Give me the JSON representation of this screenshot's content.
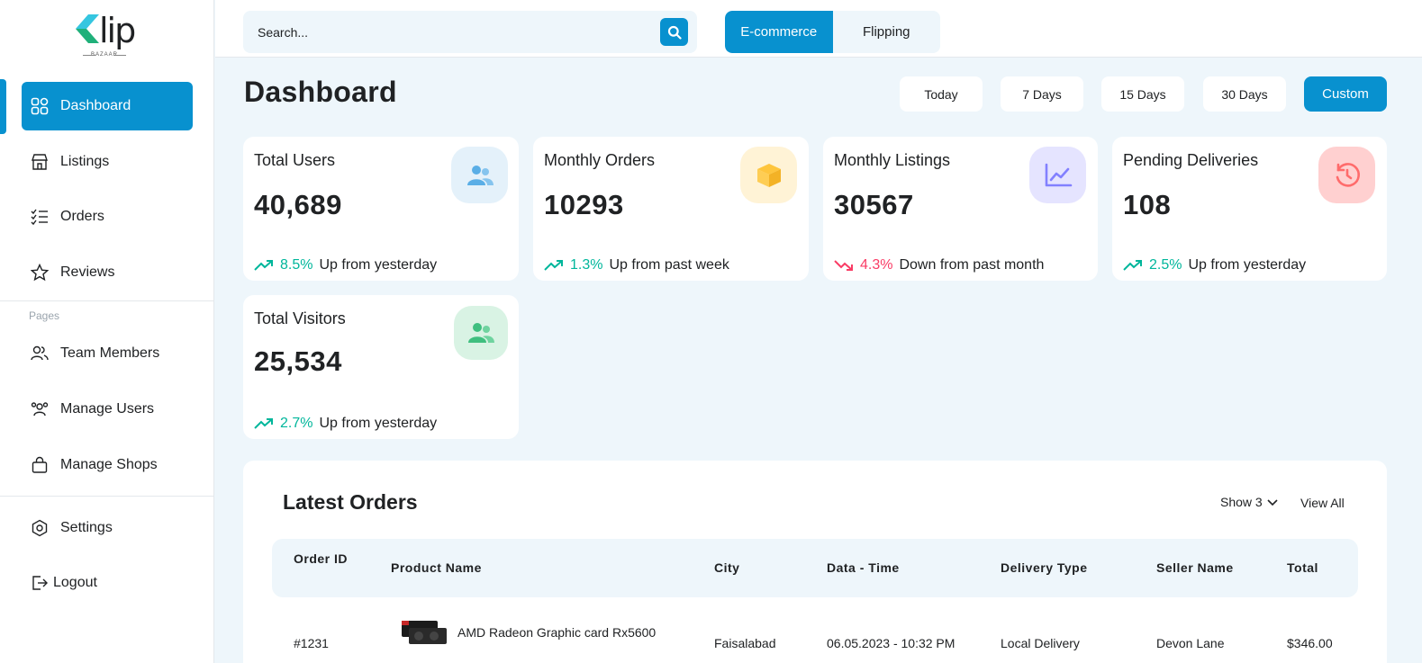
{
  "brand": {
    "logo_text": "lip",
    "logo_sub": "BAZAAR"
  },
  "sidebar": {
    "items": [
      {
        "label": "Dashboard"
      },
      {
        "label": "Listings"
      },
      {
        "label": "Orders"
      },
      {
        "label": "Reviews"
      }
    ],
    "section_label": "Pages",
    "pages": [
      {
        "label": "Team Members"
      },
      {
        "label": "Manage Users"
      },
      {
        "label": "Manage Shops"
      }
    ],
    "bottom": [
      {
        "label": "Settings"
      },
      {
        "label": "Logout"
      }
    ]
  },
  "topbar": {
    "search_placeholder": "Search...",
    "segments": [
      "E-commerce",
      "Flipping"
    ],
    "active_segment": "E-commerce"
  },
  "header": {
    "title": "Dashboard",
    "ranges": [
      "Today",
      "7 Days",
      "15 Days",
      "30 Days",
      "Custom"
    ],
    "active_range": "Custom"
  },
  "cards": [
    {
      "title": "Total Users",
      "value": "40,689",
      "pct": "8.5%",
      "trend_text": "Up from yesterday",
      "direction": "up",
      "icon": "users-icon"
    },
    {
      "title": "Monthly Orders",
      "value": "10293",
      "pct": "1.3%",
      "trend_text": "Up from past week",
      "direction": "up",
      "icon": "box-icon"
    },
    {
      "title": "Monthly Listings",
      "value": "30567",
      "pct": "4.3%",
      "trend_text": "Down from past month",
      "direction": "down",
      "icon": "line-chart-icon"
    },
    {
      "title": "Pending Deliveries",
      "value": "108",
      "pct": "2.5%",
      "trend_text": "Up from yesterday",
      "direction": "up",
      "icon": "history-icon"
    },
    {
      "title": "Total Visitors",
      "value": "25,534",
      "pct": "2.7%",
      "trend_text": "Up from yesterday",
      "direction": "up",
      "icon": "visitors-icon"
    }
  ],
  "colors": {
    "accent": "#0891cf",
    "up": "#00b69b",
    "down": "#f93c65"
  },
  "orders": {
    "title": "Latest Orders",
    "show_label": "Show 3",
    "view_all": "View All",
    "columns": [
      "Order ID",
      "Product Name",
      "City",
      "Data - Time",
      "Delivery Type",
      "Seller Name",
      "Total"
    ],
    "rows": [
      {
        "id": "#1231",
        "product": "AMD Radeon Graphic card Rx5600",
        "city": "Faisalabad",
        "datetime": "06.05.2023 - 10:32 PM",
        "delivery": "Local Delivery",
        "seller": "Devon Lane",
        "total": "$346.00"
      }
    ]
  }
}
